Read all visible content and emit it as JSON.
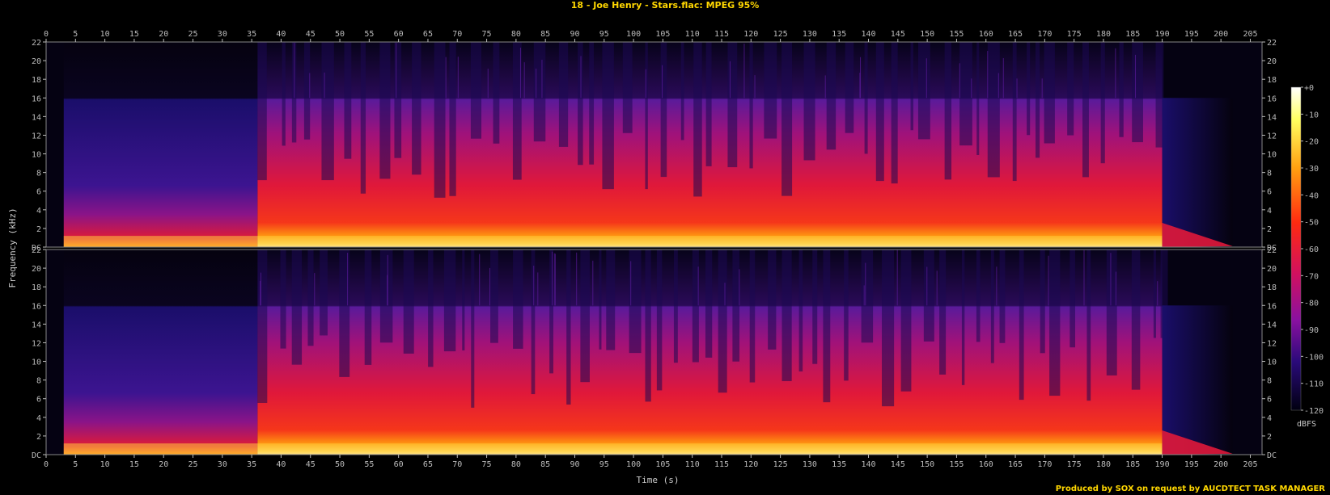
{
  "header": {
    "title": "18 - Joe Henry - Stars.flac: MPEG 95%"
  },
  "footer": {
    "credit": "Produced by SOX on request by AUCDTECT TASK MANAGER"
  },
  "colors": {
    "background": "#000000",
    "axis": "#bbbbbb",
    "title": "#ffd700"
  },
  "chart_data": {
    "type": "heatmap",
    "title": "18 - Joe Henry - Stars.flac: MPEG 95%",
    "xlabel": "Time (s)",
    "ylabel": "Frequency (kHz)",
    "xlim": [
      0,
      207
    ],
    "ylim_khz": [
      0,
      22
    ],
    "x_ticks": [
      0,
      5,
      10,
      15,
      20,
      25,
      30,
      35,
      40,
      45,
      50,
      55,
      60,
      65,
      70,
      75,
      80,
      85,
      90,
      95,
      100,
      105,
      110,
      115,
      120,
      125,
      130,
      135,
      140,
      145,
      150,
      155,
      160,
      165,
      170,
      175,
      180,
      185,
      190,
      195,
      200,
      205
    ],
    "y_ticks": [
      {
        "value": 0,
        "label": "DC"
      },
      {
        "value": 2,
        "label": "2"
      },
      {
        "value": 4,
        "label": "4"
      },
      {
        "value": 6,
        "label": "6"
      },
      {
        "value": 8,
        "label": "8"
      },
      {
        "value": 10,
        "label": "10"
      },
      {
        "value": 12,
        "label": "12"
      },
      {
        "value": 14,
        "label": "14"
      },
      {
        "value": 16,
        "label": "16"
      },
      {
        "value": 18,
        "label": "18"
      },
      {
        "value": 20,
        "label": "20"
      },
      {
        "value": 22,
        "label": "22"
      }
    ],
    "channels": 2,
    "colorbar": {
      "label": "dBFS",
      "range": [
        -120,
        0
      ],
      "ticks": [
        "+0",
        "-10",
        "-20",
        "-30",
        "-40",
        "-50",
        "-60",
        "-70",
        "-80",
        "-90",
        "-100",
        "-110",
        "-120"
      ]
    },
    "lowpass_cutoff_khz": 16,
    "music_span_s": [
      3,
      190
    ],
    "fade_out_end_s": 202
  }
}
